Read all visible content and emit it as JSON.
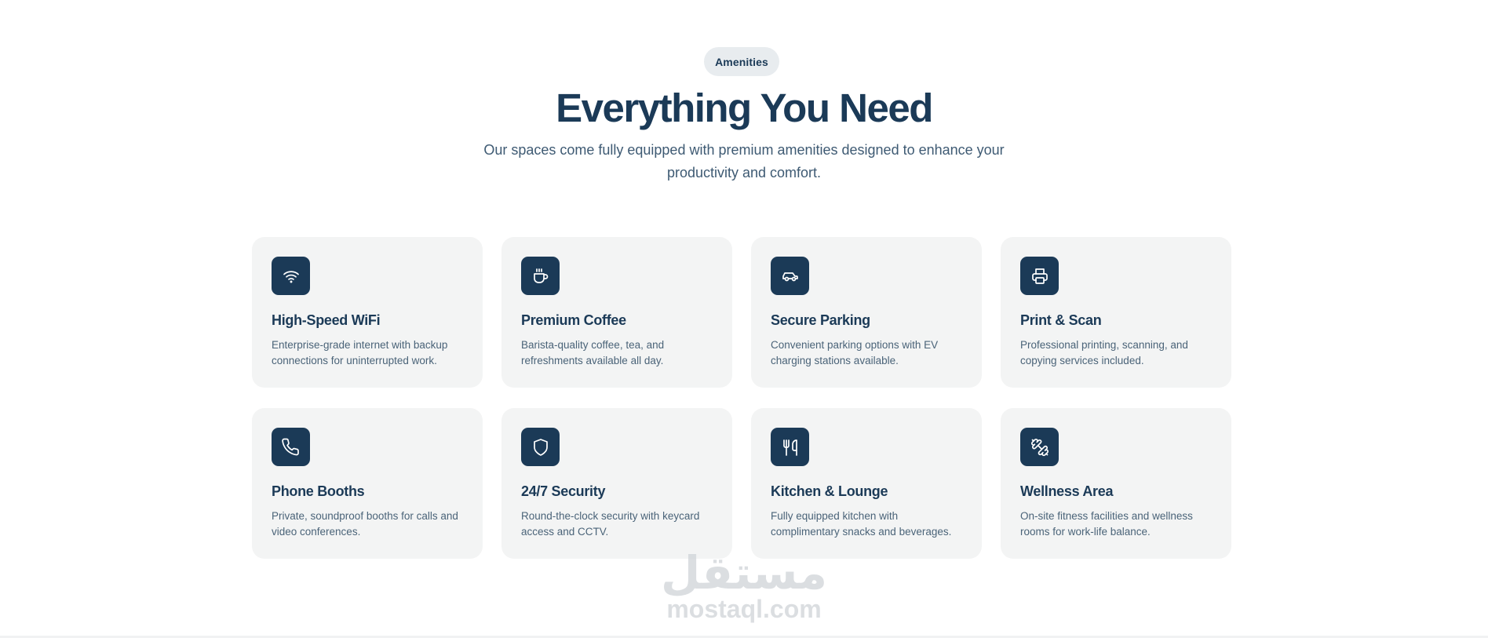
{
  "header": {
    "badge": "Amenities",
    "title": "Everything You Need",
    "subtitle": "Our spaces come fully equipped with premium amenities designed to enhance your productivity and comfort."
  },
  "colors": {
    "primary": "#1b3a57",
    "card_bg": "#f3f4f4",
    "badge_bg": "#e8ecef",
    "text_muted": "#4a6378"
  },
  "amenities": [
    {
      "icon": "wifi-icon",
      "title": "High-Speed WiFi",
      "description": "Enterprise-grade internet with backup connections for uninterrupted work."
    },
    {
      "icon": "coffee-icon",
      "title": "Premium Coffee",
      "description": "Barista-quality coffee, tea, and refreshments available all day."
    },
    {
      "icon": "car-icon",
      "title": "Secure Parking",
      "description": "Convenient parking options with EV charging stations available."
    },
    {
      "icon": "printer-icon",
      "title": "Print & Scan",
      "description": "Professional printing, scanning, and copying services included."
    },
    {
      "icon": "phone-icon",
      "title": "Phone Booths",
      "description": "Private, soundproof booths for calls and video conferences."
    },
    {
      "icon": "shield-icon",
      "title": "24/7 Security",
      "description": "Round-the-clock security with keycard access and CCTV."
    },
    {
      "icon": "utensils-icon",
      "title": "Kitchen & Lounge",
      "description": "Fully equipped kitchen with complimentary snacks and beverages."
    },
    {
      "icon": "dumbbell-icon",
      "title": "Wellness Area",
      "description": "On-site fitness facilities and wellness rooms for work-life balance."
    }
  ],
  "watermark": {
    "arabic": "مستقل",
    "latin": "mostaql.com"
  }
}
